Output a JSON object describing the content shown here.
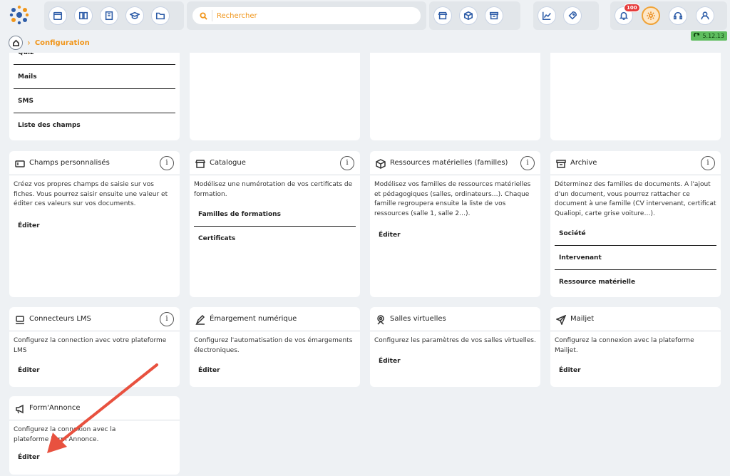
{
  "search": {
    "placeholder": "Rechercher"
  },
  "notifications": {
    "count": "100"
  },
  "breadcrumb": {
    "current": "Configuration"
  },
  "version": "5.12.13",
  "top_cards": {
    "col1_items": [
      "Quiz",
      "Mails",
      "SMS",
      "Liste des champs"
    ]
  },
  "cards": {
    "champs": {
      "title": "Champs personnalisés",
      "desc": "Créez vos propres champs de saisie sur vos fiches. Vous pourrez saisir ensuite une valeur et éditer ces valeurs sur vos documents.",
      "link": "Éditer"
    },
    "catalogue": {
      "title": "Catalogue",
      "desc": "Modélisez une numérotation de vos certificats de formation.",
      "items": [
        "Familles de formations",
        "Certificats"
      ]
    },
    "ressources": {
      "title": "Ressources matérielles (familles)",
      "desc": "Modélisez vos familles de ressources matérielles et pédagogiques (salles, ordinateurs…). Chaque famille regroupera ensuite la liste de vos ressources (salle 1, salle 2…).",
      "link": "Éditer"
    },
    "archive": {
      "title": "Archive",
      "desc": "Déterminez des familles de documents. A l'ajout d'un document, vous pourrez rattacher ce document à une famille (CV intervenant, certificat Qualiopi, carte grise voiture…).",
      "items": [
        "Société",
        "Intervenant",
        "Ressource matérielle"
      ]
    },
    "lms": {
      "title": "Connecteurs LMS",
      "desc": "Configurez la connection avec votre plateforme LMS",
      "link": "Éditer"
    },
    "emargement": {
      "title": "Émargement numérique",
      "desc": "Configurez l'automatisation de vos émargements électroniques.",
      "link": "Éditer"
    },
    "salles": {
      "title": "Salles virtuelles",
      "desc": "Configurez les paramètres de vos salles virtuelles.",
      "link": "Éditer"
    },
    "mailjet": {
      "title": "Mailjet",
      "desc": "Configurez la connexion avec la plateforme Mailjet.",
      "link": "Éditer"
    },
    "formannonce": {
      "title": "Form'Annonce",
      "desc": "Configurez la connexion avec la plateforme Form'Annonce.",
      "link": "Éditer"
    }
  },
  "colors": {
    "accent": "#f0961c",
    "arrow": "#e8513f",
    "icon_blue": "#2e5da8"
  }
}
